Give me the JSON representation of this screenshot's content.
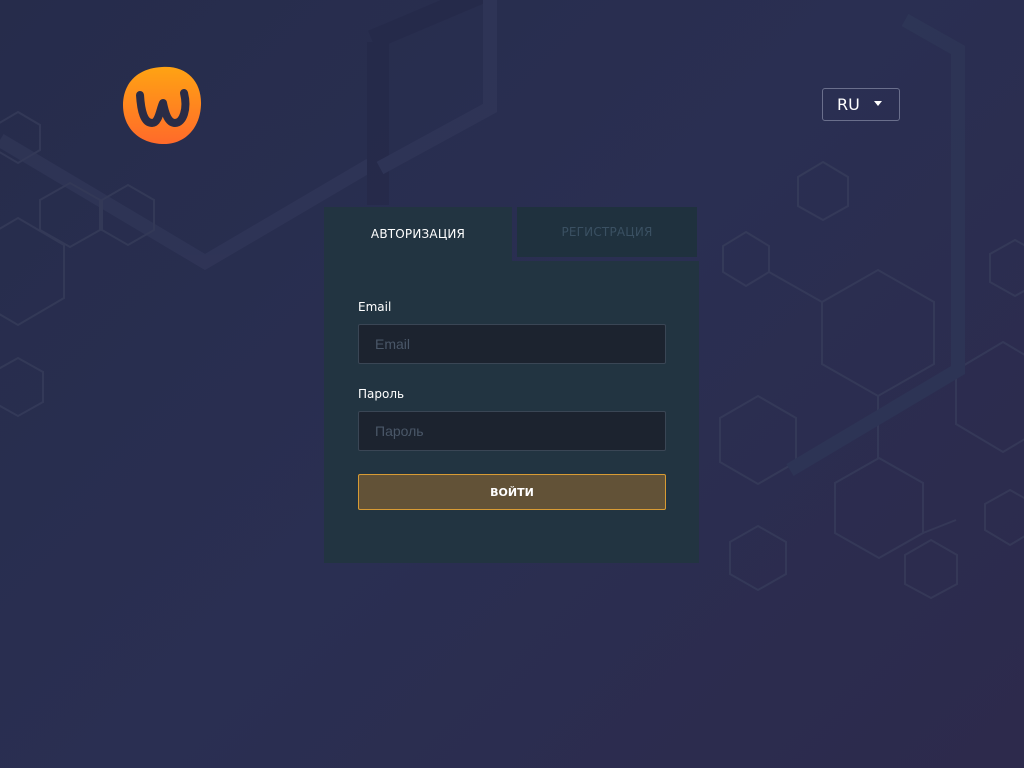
{
  "header": {
    "logo_icon": "w-logo-icon",
    "language": {
      "selected": "RU",
      "icon": "caret-down-icon"
    }
  },
  "auth": {
    "tabs": {
      "login": "АВТОРИЗАЦИЯ",
      "register": "РЕГИСТРАЦИЯ"
    },
    "email": {
      "label": "Email",
      "placeholder": "Email",
      "value": ""
    },
    "password": {
      "label": "Пароль",
      "placeholder": "Пароль",
      "value": ""
    },
    "submit_label": "ВОЙТИ"
  },
  "colors": {
    "background": "#282d4e",
    "card": "#223441",
    "inactive_tab": "#1f313e",
    "input_bg": "#1c232f",
    "accent": "#d89b34",
    "button_bg": "#625237",
    "logo_orange": "#ff8a1c"
  }
}
